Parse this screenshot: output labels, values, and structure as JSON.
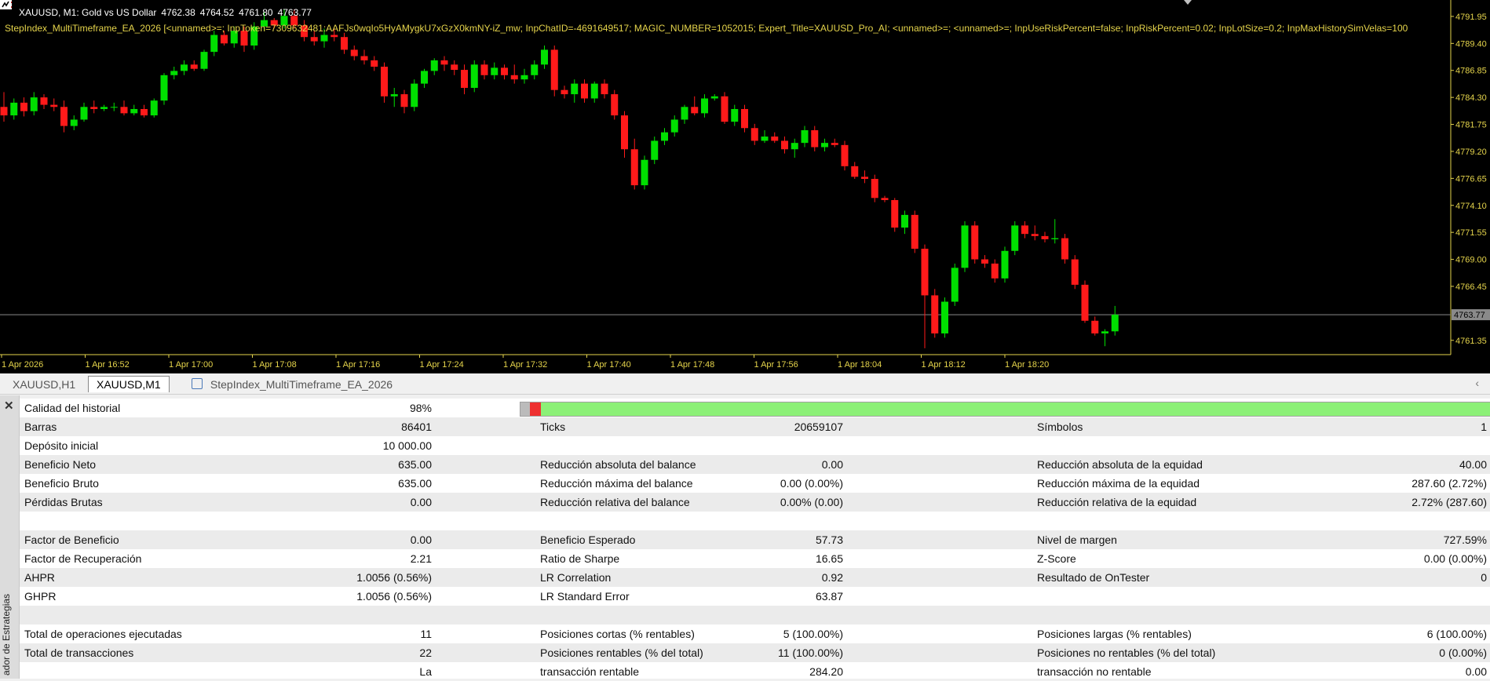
{
  "chart": {
    "symbol_line": "XAUUSD, M1:  Gold vs US Dollar",
    "ohlc": [
      "4762.38",
      "4764.52",
      "4761.80",
      "4763.77"
    ],
    "ea_params": "StepIndex_MultiTimeframe_EA_2026 [<unnamed>=; InpToken=7309632481:AAFJs0wqIo5HyAMygkU7xGzX0kmNY-iZ_mw; InpChatID=-4691649517; MAGIC_NUMBER=1052015; Expert_Title=XAUUSD_Pro_AI; <unnamed>=; <unnamed>=; InpUseRiskPercent=false; InpRiskPercent=0.02; InpLotSize=0.2; InpMaxHistorySimVelas=100",
    "price_labels": [
      "4791.95",
      "4789.40",
      "4786.85",
      "4784.30",
      "4781.75",
      "4779.20",
      "4776.65",
      "4774.10",
      "4771.55",
      "4769.00",
      "4766.45",
      "4763.77",
      "4761.35"
    ],
    "current_price": "4763.77",
    "time_labels": [
      "1 Apr 2026",
      "1 Apr 16:52",
      "1 Apr 17:00",
      "1 Apr 17:08",
      "1 Apr 17:16",
      "1 Apr 17:24",
      "1 Apr 17:32",
      "1 Apr 17:40",
      "1 Apr 17:48",
      "1 Apr 17:56",
      "1 Apr 18:04",
      "1 Apr 18:12",
      "1 Apr 18:20"
    ],
    "colors": {
      "bull": "#00e000",
      "bear": "#ff1a1a",
      "axis": "#e5d44b",
      "bg": "#000000"
    }
  },
  "chart_data": {
    "type": "candlestick",
    "ylim": [
      4760.0,
      4793.5
    ],
    "candles": [
      [
        4783.4,
        4784.8,
        4782.0,
        4782.6
      ],
      [
        4782.6,
        4784.2,
        4782.2,
        4783.8
      ],
      [
        4783.8,
        4784.3,
        4782.5,
        4783.0
      ],
      [
        4783.0,
        4784.8,
        4782.6,
        4784.3
      ],
      [
        4784.3,
        4784.6,
        4783.2,
        4783.6
      ],
      [
        4783.6,
        4784.2,
        4783.0,
        4783.4
      ],
      [
        4783.4,
        4784.0,
        4781.0,
        4781.6
      ],
      [
        4781.6,
        4782.6,
        4781.2,
        4782.2
      ],
      [
        4782.2,
        4783.8,
        4782.0,
        4783.4
      ],
      [
        4783.4,
        4784.0,
        4782.8,
        4783.2
      ],
      [
        4783.2,
        4783.6,
        4783.0,
        4783.4
      ],
      [
        4783.4,
        4783.8,
        4783.0,
        4783.4
      ],
      [
        4783.4,
        4784.0,
        4782.6,
        4782.8
      ],
      [
        4782.8,
        4783.6,
        4782.6,
        4783.2
      ],
      [
        4783.2,
        4783.6,
        4782.4,
        4782.6
      ],
      [
        4782.6,
        4784.2,
        4782.4,
        4784.0
      ],
      [
        4784.0,
        4786.6,
        4783.6,
        4786.4
      ],
      [
        4786.4,
        4787.2,
        4786.0,
        4786.8
      ],
      [
        4786.8,
        4787.8,
        4786.4,
        4787.4
      ],
      [
        4787.4,
        4787.8,
        4786.8,
        4787.0
      ],
      [
        4787.0,
        4788.8,
        4786.8,
        4788.6
      ],
      [
        4788.6,
        4790.6,
        4788.2,
        4790.2
      ],
      [
        4790.2,
        4790.6,
        4789.2,
        4789.4
      ],
      [
        4789.4,
        4791.0,
        4789.0,
        4790.6
      ],
      [
        4790.6,
        4791.0,
        4788.6,
        4789.2
      ],
      [
        4789.2,
        4791.4,
        4788.8,
        4791.0
      ],
      [
        4791.0,
        4792.4,
        4790.6,
        4791.6
      ],
      [
        4791.6,
        4791.8,
        4790.8,
        4791.1
      ],
      [
        4791.1,
        4792.6,
        4790.8,
        4792.0
      ],
      [
        4792.0,
        4792.6,
        4790.8,
        4791.1
      ],
      [
        4791.1,
        4791.6,
        4789.6,
        4790.0
      ],
      [
        4790.0,
        4790.6,
        4789.2,
        4789.6
      ],
      [
        4789.6,
        4790.8,
        4789.0,
        4790.2
      ],
      [
        4790.2,
        4790.8,
        4789.6,
        4790.0
      ],
      [
        4790.0,
        4790.4,
        4788.4,
        4788.8
      ],
      [
        4788.8,
        4789.2,
        4787.8,
        4788.2
      ],
      [
        4788.2,
        4788.8,
        4787.4,
        4787.8
      ],
      [
        4787.8,
        4788.2,
        4786.8,
        4787.2
      ],
      [
        4787.2,
        4787.6,
        4783.8,
        4784.4
      ],
      [
        4784.4,
        4785.2,
        4783.4,
        4784.6
      ],
      [
        4784.6,
        4785.0,
        4782.8,
        4783.4
      ],
      [
        4783.4,
        4786.0,
        4783.0,
        4785.6
      ],
      [
        4785.6,
        4787.0,
        4785.2,
        4786.8
      ],
      [
        4786.8,
        4788.0,
        4786.4,
        4787.8
      ],
      [
        4787.8,
        4788.2,
        4786.8,
        4787.4
      ],
      [
        4787.4,
        4787.8,
        4786.4,
        4786.9
      ],
      [
        4786.9,
        4787.4,
        4784.6,
        4785.2
      ],
      [
        4785.2,
        4787.8,
        4784.8,
        4787.4
      ],
      [
        4787.4,
        4787.8,
        4786.0,
        4786.4
      ],
      [
        4786.4,
        4787.6,
        4786.0,
        4787.1
      ],
      [
        4787.1,
        4787.4,
        4786.0,
        4786.4
      ],
      [
        4786.4,
        4787.4,
        4785.6,
        4786.0
      ],
      [
        4786.0,
        4787.0,
        4785.6,
        4786.4
      ],
      [
        4786.4,
        4787.8,
        4786.0,
        4787.4
      ],
      [
        4787.4,
        4789.2,
        4787.0,
        4788.8
      ],
      [
        4788.8,
        4789.2,
        4784.4,
        4785.0
      ],
      [
        4785.0,
        4785.4,
        4784.2,
        4784.6
      ],
      [
        4784.6,
        4786.0,
        4783.8,
        4785.6
      ],
      [
        4785.6,
        4786.0,
        4783.8,
        4784.2
      ],
      [
        4784.2,
        4785.8,
        4783.8,
        4785.6
      ],
      [
        4785.6,
        4786.0,
        4784.2,
        4784.6
      ],
      [
        4784.6,
        4785.0,
        4782.2,
        4782.6
      ],
      [
        4782.6,
        4783.0,
        4778.6,
        4779.4
      ],
      [
        4779.4,
        4780.4,
        4775.6,
        4776.0
      ],
      [
        4776.0,
        4778.8,
        4775.6,
        4778.4
      ],
      [
        4778.4,
        4780.6,
        4778.0,
        4780.2
      ],
      [
        4780.2,
        4781.4,
        4779.8,
        4781.0
      ],
      [
        4781.0,
        4782.6,
        4780.6,
        4782.2
      ],
      [
        4782.2,
        4783.6,
        4781.8,
        4783.4
      ],
      [
        4783.4,
        4784.4,
        4782.6,
        4782.8
      ],
      [
        4782.8,
        4784.6,
        4782.4,
        4784.2
      ],
      [
        4784.2,
        4784.6,
        4784.0,
        4784.4
      ],
      [
        4784.4,
        4784.8,
        4781.8,
        4782.0
      ],
      [
        4782.0,
        4783.6,
        4781.6,
        4783.2
      ],
      [
        4783.2,
        4783.6,
        4781.0,
        4781.4
      ],
      [
        4781.4,
        4781.8,
        4779.8,
        4780.2
      ],
      [
        4780.2,
        4781.2,
        4780.0,
        4780.6
      ],
      [
        4780.6,
        4781.0,
        4780.0,
        4780.2
      ],
      [
        4780.2,
        4780.6,
        4779.0,
        4779.4
      ],
      [
        4779.4,
        4780.4,
        4778.6,
        4780.0
      ],
      [
        4780.0,
        4781.6,
        4779.6,
        4781.2
      ],
      [
        4781.2,
        4781.6,
        4779.2,
        4779.6
      ],
      [
        4779.6,
        4780.4,
        4779.2,
        4780.0
      ],
      [
        4780.0,
        4780.4,
        4779.6,
        4779.8
      ],
      [
        4779.8,
        4780.2,
        4777.4,
        4777.8
      ],
      [
        4777.8,
        4778.2,
        4776.6,
        4776.8
      ],
      [
        4776.8,
        4777.4,
        4776.2,
        4776.6
      ],
      [
        4776.6,
        4777.0,
        4774.4,
        4774.8
      ],
      [
        4774.8,
        4775.0,
        4774.4,
        4774.6
      ],
      [
        4774.6,
        4774.8,
        4771.6,
        4772.0
      ],
      [
        4772.0,
        4773.6,
        4771.4,
        4773.2
      ],
      [
        4773.2,
        4773.6,
        4769.6,
        4770.0
      ],
      [
        4770.0,
        4770.4,
        4760.6,
        4765.6
      ],
      [
        4765.6,
        4766.2,
        4761.6,
        4762.0
      ],
      [
        4762.0,
        4765.4,
        4761.6,
        4765.0
      ],
      [
        4765.0,
        4768.6,
        4764.6,
        4768.2
      ],
      [
        4768.2,
        4772.6,
        4767.8,
        4772.2
      ],
      [
        4772.2,
        4772.6,
        4768.6,
        4769.0
      ],
      [
        4769.0,
        4769.4,
        4768.2,
        4768.6
      ],
      [
        4768.6,
        4769.0,
        4766.8,
        4767.2
      ],
      [
        4767.2,
        4770.2,
        4766.8,
        4769.8
      ],
      [
        4769.8,
        4772.6,
        4769.4,
        4772.2
      ],
      [
        4772.2,
        4772.6,
        4771.0,
        4771.4
      ],
      [
        4771.4,
        4772.2,
        4770.8,
        4771.2
      ],
      [
        4771.2,
        4771.6,
        4770.6,
        4770.9
      ],
      [
        4770.9,
        4772.8,
        4770.5,
        4771.0
      ],
      [
        4771.0,
        4771.4,
        4768.6,
        4769.0
      ],
      [
        4769.0,
        4769.4,
        4766.2,
        4766.6
      ],
      [
        4766.6,
        4767.0,
        4763.0,
        4763.2
      ],
      [
        4763.2,
        4763.6,
        4761.8,
        4762.0
      ],
      [
        4762.0,
        4762.4,
        4760.8,
        4762.2
      ],
      [
        4762.2,
        4764.6,
        4761.8,
        4763.77
      ]
    ]
  },
  "tabs": [
    {
      "label": "XAUUSD,H1"
    },
    {
      "label": "XAUUSD,M1"
    },
    {
      "label": "StepIndex_MultiTimeframe_EA_2026"
    }
  ],
  "side_label": "ador de Estrategias",
  "report": {
    "quality": {
      "label": "Calidad del historial",
      "value": "98%"
    },
    "rows": [
      {
        "alt": true,
        "c": [
          "Barras",
          "86401",
          "Ticks",
          "20659107",
          "Símbolos",
          "1"
        ]
      },
      {
        "alt": false,
        "c": [
          "Depósito inicial",
          "10 000.00",
          "",
          "",
          "",
          ""
        ]
      },
      {
        "alt": true,
        "c": [
          "Beneficio Neto",
          "635.00",
          "Reducción absoluta del balance",
          "0.00",
          "Reducción absoluta de la equidad",
          "40.00"
        ]
      },
      {
        "alt": false,
        "c": [
          "Beneficio Bruto",
          "635.00",
          "Reducción máxima del balance",
          "0.00 (0.00%)",
          "Reducción máxima de la equidad",
          "287.60 (2.72%)"
        ]
      },
      {
        "alt": true,
        "c": [
          "Pérdidas Brutas",
          "0.00",
          "Reducción relativa del balance",
          "0.00% (0.00)",
          "Reducción relativa de la equidad",
          "2.72% (287.60)"
        ]
      },
      {
        "alt": false,
        "c": [
          "",
          "",
          "",
          "",
          "",
          ""
        ]
      },
      {
        "alt": true,
        "c": [
          "Factor de Beneficio",
          "0.00",
          "Beneficio Esperado",
          "57.73",
          "Nivel de margen",
          "727.59%"
        ]
      },
      {
        "alt": false,
        "c": [
          "Factor de Recuperación",
          "2.21",
          "Ratio de Sharpe",
          "16.65",
          "Z-Score",
          "0.00 (0.00%)"
        ]
      },
      {
        "alt": true,
        "c": [
          "AHPR",
          "1.0056 (0.56%)",
          "LR Correlation",
          "0.92",
          "Resultado de OnTester",
          "0"
        ]
      },
      {
        "alt": false,
        "c": [
          "GHPR",
          "1.0056 (0.56%)",
          "LR Standard Error",
          "63.87",
          "",
          ""
        ]
      },
      {
        "alt": true,
        "c": [
          "",
          "",
          "",
          "",
          "",
          ""
        ]
      },
      {
        "alt": false,
        "c": [
          "Total de operaciones ejecutadas",
          "11",
          "Posiciones cortas (% rentables)",
          "5 (100.00%)",
          "Posiciones largas (% rentables)",
          "6 (100.00%)"
        ]
      },
      {
        "alt": true,
        "c": [
          "Total de transacciones",
          "22",
          "Posiciones rentables (% del total)",
          "11 (100.00%)",
          "Posiciones no rentables (% del total)",
          "0 (0.00%)"
        ]
      },
      {
        "alt": false,
        "c": [
          "",
          "La",
          "transacción rentable",
          "284.20",
          "transacción no rentable",
          "0.00"
        ]
      }
    ]
  }
}
